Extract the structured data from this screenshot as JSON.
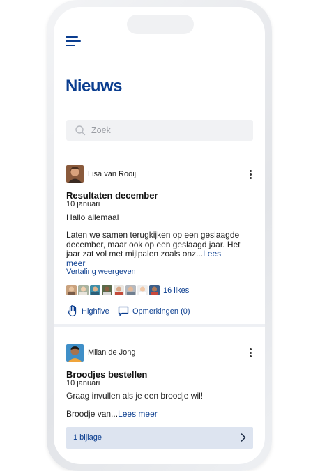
{
  "header": {
    "title": "Nieuws"
  },
  "search": {
    "placeholder": "Zoek"
  },
  "posts": [
    {
      "author": "Lisa van Rooij",
      "title": "Resultaten december",
      "date": "10 januari",
      "greeting": "Hallo allemaal",
      "body": "Laten we samen terugkijken op een geslaagde december, maar ook op een geslaagd jaar. Het jaar zat vol met mijlpalen zoals onz...",
      "read_more": "Lees meer",
      "translate": "Vertaling weergeven",
      "likes": "16 likes",
      "highfive_label": "Highfive",
      "comments_label": "Opmerkingen (0)"
    },
    {
      "author": "Milan de Jong",
      "title": "Broodjes bestellen",
      "date": "10 januari",
      "body": "Graag invullen als je een broodje wil!",
      "teaser": "Broodje van...",
      "read_more": "Lees meer",
      "attachment": "1 bijlage"
    }
  ],
  "colors": {
    "accent": "#0a3d8f",
    "attachment_bg": "#dde4f0",
    "search_bg": "#f1f2f4"
  },
  "icons": {
    "menu": "hamburger-menu-icon",
    "search": "search-icon",
    "more": "more-vertical-icon",
    "highfive": "hand-icon",
    "comments": "comment-icon",
    "attachment": "chevron-right-icon"
  }
}
